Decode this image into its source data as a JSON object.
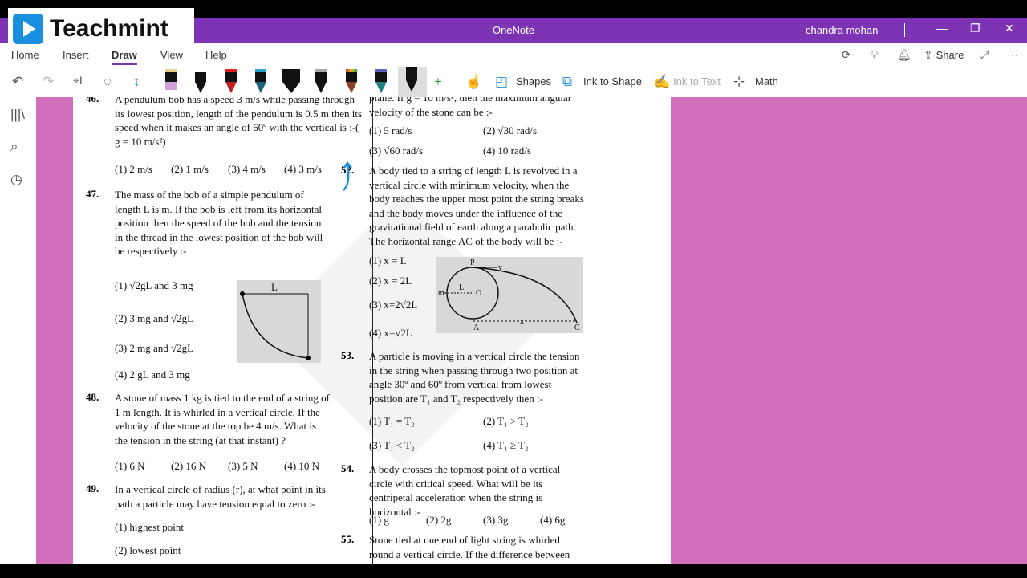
{
  "app": {
    "title": "OneNote",
    "user": "chandra mohan",
    "logo": "Teachmint",
    "window_buttons": [
      "minimize-icon",
      "restore-icon",
      "close-icon"
    ]
  },
  "menu": {
    "items": [
      "Home",
      "Insert",
      "Draw",
      "View",
      "Help"
    ],
    "active": "Draw",
    "share": "Share"
  },
  "toolbar": {
    "shapes": "Shapes",
    "ink_to_shape": "Ink to Shape",
    "ink_to_text": "Ink to Text",
    "math": "Math",
    "pens": [
      "#d0a0d8",
      "#ffffff",
      "#e02020",
      "#2aa0d0",
      "#ffffff",
      "#a0a0a0",
      "#e08020",
      "#6060c0",
      "#111111"
    ]
  },
  "colors": {
    "titlebar": "#7c34b4",
    "canvas": "#d26fbc",
    "ink": "#1a8fe0"
  },
  "left": {
    "q46": {
      "num": "46.",
      "text": "A pendulum bob has a speed 3 m/s while passing through its lowest position, length of the pendulum is 0.5 m then its speed when it makes an angle of 60º with the vertical is :-( g = 10 m/s²)",
      "opts": [
        "(1) 2 m/s",
        "(2) 1 m/s",
        "(3) 4 m/s",
        "(4) 3 m/s"
      ]
    },
    "q47": {
      "num": "47.",
      "text": "The mass of the bob of a simple pendulum of length L is m. If the bob is left from its horizontal position then the speed of the bob and the tension in the thread in the lowest position of the bob will be respectively :-",
      "opts": [
        "(1) √2gL and 3 mg",
        "(2) 3 mg and √2gL",
        "(3) 2 mg and √2gL",
        "(4) 2 gL and 3 mg"
      ],
      "fig_label": "L"
    },
    "q48": {
      "num": "48.",
      "text": "A stone of mass 1 kg is tied to the end of a string of 1 m length. It is whirled in a vertical circle. If the velocity of the stone at the top be 4 m/s. What is the tension in the string (at that instant) ?",
      "opts": [
        "(1) 6 N",
        "(2) 16 N",
        "(3) 5 N",
        "(4) 10 N"
      ]
    },
    "q49": {
      "num": "49.",
      "text": "In a vertical circle of radius (r), at what point in its path a particle may have tension equal to zero :-",
      "opts": [
        "(1) highest point",
        "(2) lowest point"
      ]
    }
  },
  "right": {
    "q51": {
      "text": "plane. If g = 10 m/s², then the maximum angular velocity of the stone can be :-",
      "opts": [
        "(1) 5 rad/s",
        "(2) √30 rad/s",
        "(3) √60 rad/s",
        "(4) 10 rad/s"
      ]
    },
    "q52": {
      "num": "52.",
      "text": "A body tied to a string of length L is revolved in a vertical circle with minimum velocity, when the body reaches the upper most point the string breaks and the body moves under the influence of the gravitational field of earth along a parabolic path. The horizontal range AC of the body will be :-",
      "opts": [
        "(1) x = L",
        "(2) x = 2L",
        "(3) x=2√2L",
        "(4) x=√2L"
      ],
      "fig_labels": [
        "P",
        "v",
        "L",
        "O",
        "m",
        "A",
        "x",
        "C"
      ]
    },
    "q53": {
      "num": "53.",
      "text": "A particle is moving in a vertical circle the tension in the string when passing through two position at angle 30º and 60º from vertical from lowest position are T₁ and T₂ respectively then :-",
      "opts": [
        "(1) T₁ = T₂",
        "(2) T₁ > T₂",
        "(3) T₁ < T₂",
        "(4) T₁ ≥ T₂"
      ]
    },
    "q54": {
      "num": "54.",
      "text": "A body crosses the topmost point of a vertical circle with critical speed. What will be its centripetal acceleration when the string is horizontal :-",
      "opts": [
        "(1) g",
        "(2) 2g",
        "(3) 3g",
        "(4) 6g"
      ]
    },
    "q55": {
      "num": "55.",
      "text": "Stone tied at one end of light string is whirled round a vertical circle. If the difference between the"
    }
  }
}
